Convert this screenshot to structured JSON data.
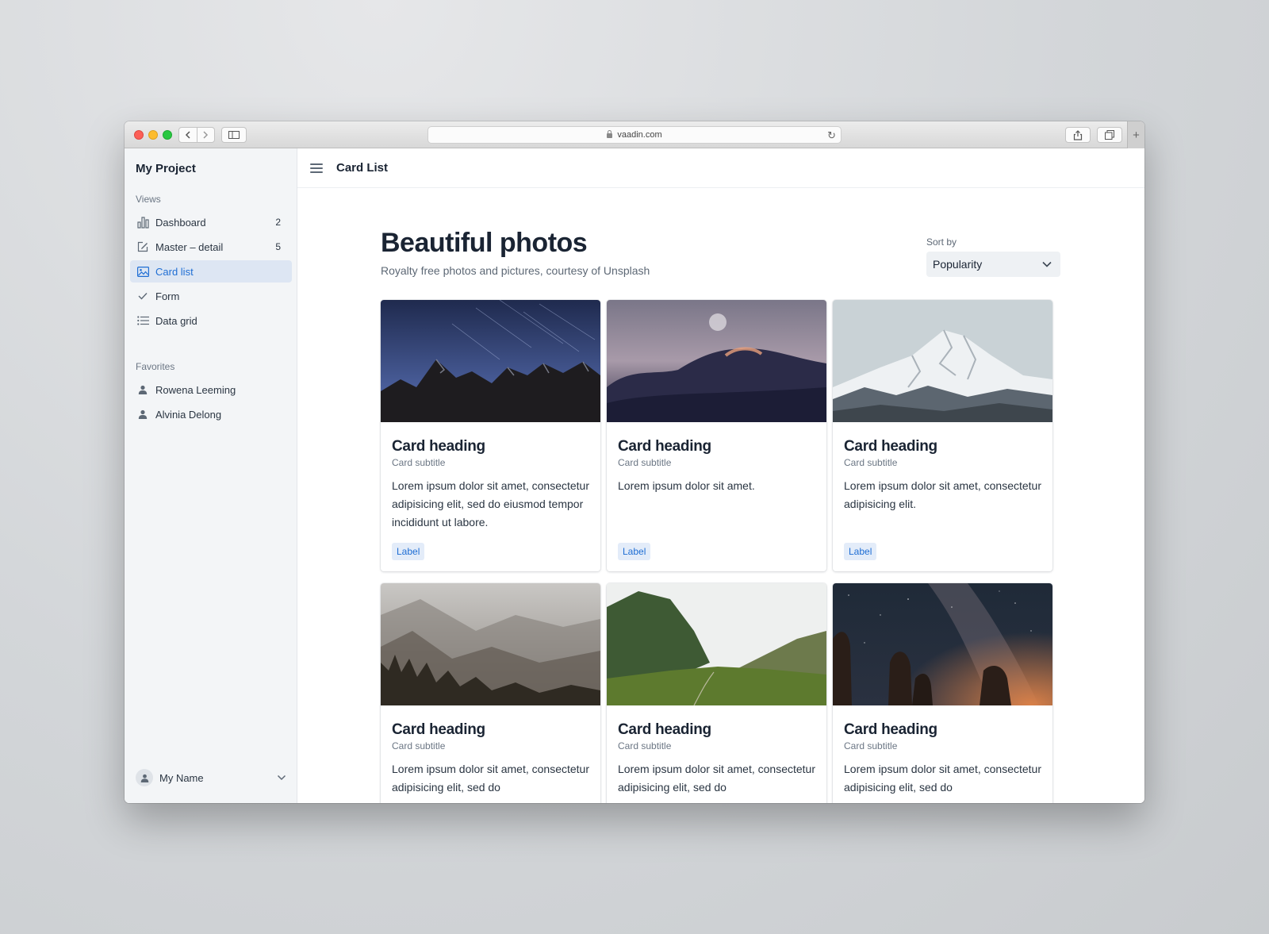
{
  "browser": {
    "url": "vaadin.com"
  },
  "sidebar": {
    "project_title": "My Project",
    "views_label": "Views",
    "views": [
      {
        "label": "Dashboard",
        "count": "2",
        "icon": "bar-chart-icon"
      },
      {
        "label": "Master – detail",
        "count": "5",
        "icon": "edit-icon"
      },
      {
        "label": "Card list",
        "count": "",
        "icon": "image-icon",
        "active": true
      },
      {
        "label": "Form",
        "count": "",
        "icon": "check-icon"
      },
      {
        "label": "Data grid",
        "count": "",
        "icon": "list-icon"
      }
    ],
    "favorites_label": "Favorites",
    "favorites": [
      {
        "label": "Rowena Leeming",
        "icon": "user-icon"
      },
      {
        "label": "Alvinia Delong",
        "icon": "user-icon"
      }
    ],
    "user_name": "My Name"
  },
  "topbar": {
    "title": "Card List"
  },
  "page": {
    "title": "Beautiful photos",
    "subtitle": "Royalty free photos and pictures, courtesy of Unsplash",
    "sort_label": "Sort by",
    "sort_value": "Popularity"
  },
  "cards": [
    {
      "heading": "Card heading",
      "subtitle": "Card subtitle",
      "text": "Lorem ipsum dolor sit amet, consectetur adipisicing elit, sed do eiusmod tempor incididunt ut labore.",
      "badge": "Label"
    },
    {
      "heading": "Card heading",
      "subtitle": "Card subtitle",
      "text": "Lorem ipsum dolor sit amet.",
      "badge": "Label"
    },
    {
      "heading": "Card heading",
      "subtitle": "Card subtitle",
      "text": "Lorem ipsum dolor sit amet, consectetur adipisicing elit.",
      "badge": "Label"
    },
    {
      "heading": "Card heading",
      "subtitle": "Card subtitle",
      "text": "Lorem ipsum dolor sit amet, consectetur adipisicing elit, sed do",
      "badge": ""
    },
    {
      "heading": "Card heading",
      "subtitle": "Card subtitle",
      "text": "Lorem ipsum dolor sit amet, consectetur adipisicing elit, sed do",
      "badge": ""
    },
    {
      "heading": "Card heading",
      "subtitle": "Card subtitle",
      "text": "Lorem ipsum dolor sit amet, consectetur adipisicing elit, sed do",
      "badge": ""
    }
  ],
  "colors": {
    "accent": "#1f6ed4",
    "active_nav_bg": "#dde6f3",
    "badge_bg": "#e3ecf9"
  }
}
